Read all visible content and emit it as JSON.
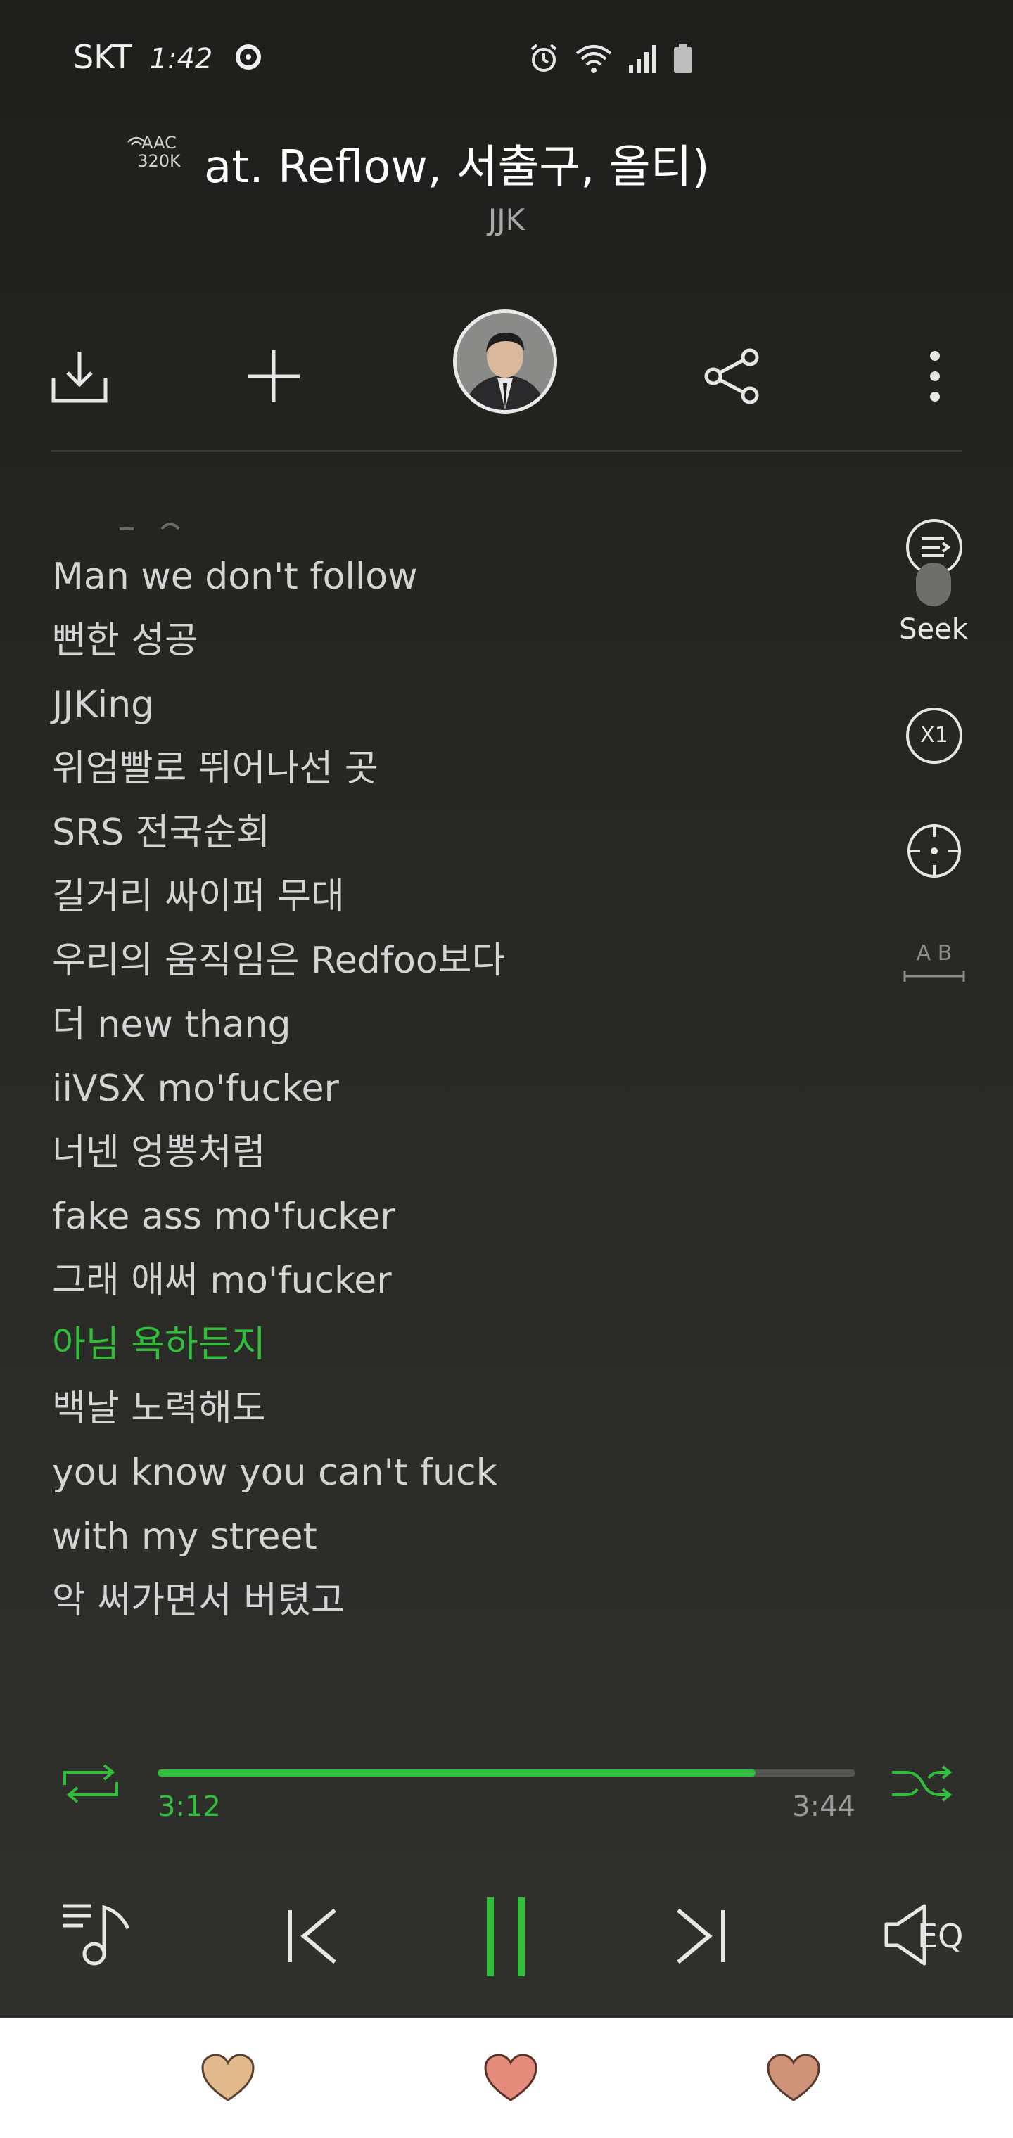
{
  "status_bar": {
    "carrier": "SKT",
    "carrier_extra": "1:42"
  },
  "now_playing": {
    "quality_codec": "AAC",
    "quality_bitrate": "320K",
    "title_visible": "at. Reflow, 서출구, 올티)",
    "artist": "JJK"
  },
  "actions": {
    "download_icon": "download-icon",
    "add_icon": "plus-icon",
    "share_icon": "share-icon",
    "more_icon": "more-vertical-icon"
  },
  "lyrics": [
    "Man we don't follow",
    "뻔한 성공",
    "JJKing",
    "위엄빨로 뛰어나선 곳",
    "SRS 전국순회",
    "길거리 싸이퍼 무대",
    "우리의 움직임은 Redfoo보다",
    "더 new thang",
    "iiVSX mo'fucker",
    "너넨 엉뽕처럼",
    "fake ass mo'fucker",
    "그래 애써 mo'fucker",
    "아님 욕하든지",
    "백날 노력해도",
    "you know you can't fuck",
    "with my street",
    "악 써가면서 버텼고"
  ],
  "active_lyric_index": 12,
  "side_tools": {
    "seek_label": "Seek",
    "speed_label": "X1",
    "ab_label": "A B"
  },
  "playback": {
    "current_time": "3:12",
    "total_time": "3:44",
    "progress_fraction": 0.857
  },
  "controls": {
    "eq_label": "EQ"
  },
  "colors": {
    "accent": "#2fbf3a",
    "background": "#262622",
    "heart_1": "#e2b98d",
    "heart_2": "#e38c7c",
    "heart_3": "#cf937a"
  }
}
